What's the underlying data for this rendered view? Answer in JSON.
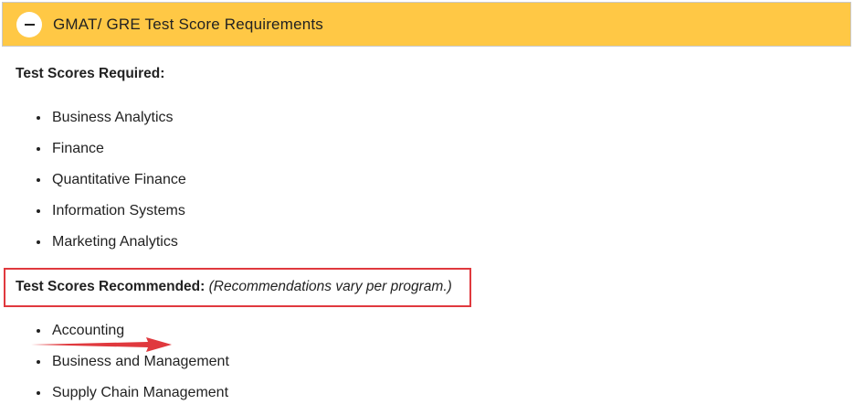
{
  "accordion": {
    "title": "GMAT/ GRE Test Score Requirements",
    "toggle_icon": "minus-icon",
    "background_color": "#ffc845"
  },
  "required": {
    "heading": "Test Scores Required:",
    "items": [
      "Business Analytics",
      "Finance",
      "Quantitative Finance",
      "Information Systems",
      "Marketing Analytics"
    ]
  },
  "recommended": {
    "heading": "Test Scores Recommended:",
    "note": "(Recommendations vary per program.)",
    "items": [
      "Accounting",
      "Business and Management",
      "Supply Chain Management"
    ]
  },
  "annotations": {
    "highlight_color": "#e0393e",
    "arrow_icon": "right-arrow-annotation"
  }
}
